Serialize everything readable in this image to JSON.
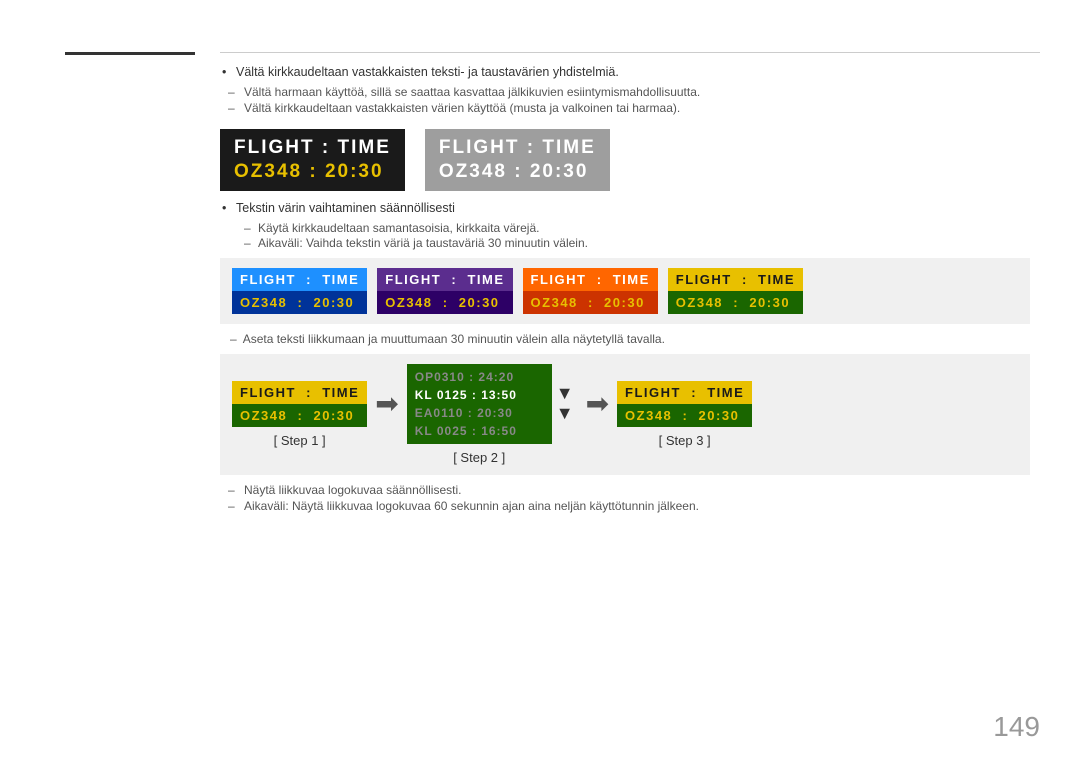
{
  "page": {
    "number": "149"
  },
  "bullets": [
    "Vältä kirkkaudeltaan vastakkaisten teksti- ja taustavärien yhdistelmiä."
  ],
  "dashes": [
    "Vältä harmaan käyttöä, sillä se saattaa kasvattaa jälkikuvien esiintymismahdollisuutta.",
    "Vältä kirkkaudeltaan vastakkaisten värien käyttöä (musta ja valkoinen tai harmaa)."
  ],
  "panel1": {
    "row1": "FLIGHT  :  TIME",
    "row2": "OZ348   :  20:30"
  },
  "panel2": {
    "row1": "FLIGHT  :  TIME",
    "row2": "OZ348  :  20:30"
  },
  "textin_vaarin": "Tekstin värin vaihtaminen säännöllisesti",
  "sub_bullets": [
    "Käytä kirkkaudeltaan samantasoisia, kirkkaita värejä.",
    "Aikaväli: Vaihda tekstin väriä ja taustaväriä 30 minuutin välein."
  ],
  "color_variants": [
    {
      "bg_top": "#1e90ff",
      "bg_bot": "#003399",
      "r1": "FLIGHT  :  TIME",
      "r2": "OZ348   :  20:30",
      "r1color": "#fff",
      "r2color": "#e8c000"
    },
    {
      "bg_top": "#5b2d8e",
      "bg_bot": "#2d0066",
      "r1": "FLIGHT  :  TIME",
      "r2": "OZ348   :  20:30",
      "r1color": "#fff",
      "r2color": "#e8c000"
    },
    {
      "bg_top": "#ff6600",
      "bg_bot": "#cc3300",
      "r1": "FLIGHT  :  TIME",
      "r2": "OZ348   :  20:30",
      "r1color": "#fff",
      "r2color": "#e8c000"
    },
    {
      "bg_top": "#e8c000",
      "bg_bot": "#1a6600",
      "r1": "FLIGHT  :  TIME",
      "r2": "OZ348   :  20:30",
      "r1color": "#1a1a1a",
      "r2color": "#e8c000"
    }
  ],
  "step_note": "Aseta teksti liikkumaan ja muuttumaan 30 minuutin välein alla näytetyllä tavalla.",
  "steps": [
    {
      "label": "[ Step 1 ]"
    },
    {
      "label": "[ Step 2 ]"
    },
    {
      "label": "[ Step 3 ]"
    }
  ],
  "step2_rows": [
    {
      "text": "OP0310 :  24:20",
      "dim": true
    },
    {
      "text": "KL 0125 :  13:50",
      "dim": false
    },
    {
      "text": "EA0110 :  20:30",
      "dim": true
    },
    {
      "text": "KL 0025 :  16:50",
      "dim": true
    }
  ],
  "logo_note1": "Näytä liikkuvaa logokuvaa säännöllisesti.",
  "logo_note2": "Aikaväli: Näytä liikkuvaa logokuvaa 60 sekunnin ajan aina neljän käyttötunnin jälkeen."
}
